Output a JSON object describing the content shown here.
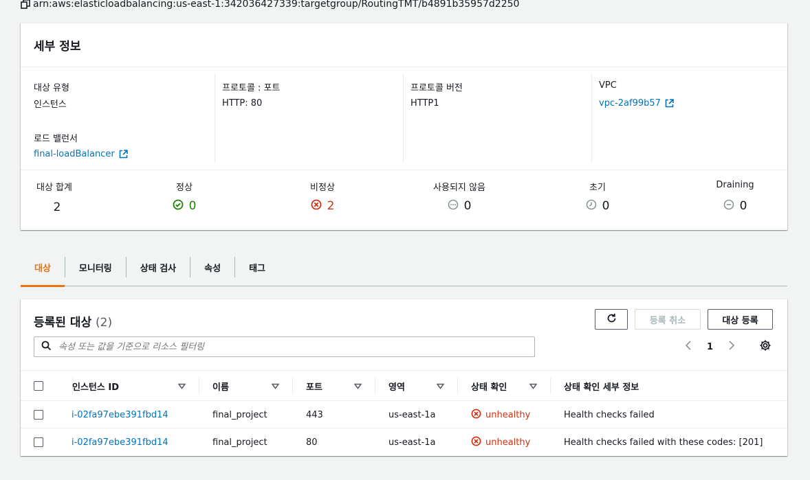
{
  "arn": "arn:aws:elasticloadbalancing:us-east-1:342036427339:targetgroup/RoutingTMT/b4891b35957d2250",
  "details": {
    "title": "세부 정보",
    "target_type_label": "대상 유형",
    "target_type_value": "인스턴스",
    "load_balancer_label": "로드 밸런서",
    "load_balancer_value": "final-loadBalancer",
    "protocol_port_label": "프로토콜 : 포트",
    "protocol_port_value": "HTTP: 80",
    "protocol_version_label": "프로토콜 버전",
    "protocol_version_value": "HTTP1",
    "vpc_label": "VPC",
    "vpc_value": "vpc-2af99b57"
  },
  "stats": {
    "total_label": "대상 합계",
    "total_value": "2",
    "healthy_label": "정상",
    "healthy_value": "0",
    "unhealthy_label": "비정상",
    "unhealthy_value": "2",
    "unused_label": "사용되지 않음",
    "unused_value": "0",
    "initial_label": "초기",
    "initial_value": "0",
    "draining_label": "Draining",
    "draining_value": "0"
  },
  "tabs": [
    {
      "label": "대상",
      "active": true
    },
    {
      "label": "모니터링",
      "active": false
    },
    {
      "label": "상태 검사",
      "active": false
    },
    {
      "label": "속성",
      "active": false
    },
    {
      "label": "태그",
      "active": false
    }
  ],
  "targets": {
    "title": "등록된 대상",
    "count": "(2)",
    "deregister_label": "등록 취소",
    "register_label": "대상 등록",
    "search_placeholder": "속성 또는 값을 기준으로 리소스 필터링",
    "page": "1",
    "columns": [
      "인스턴스 ID",
      "이름",
      "포트",
      "영역",
      "상태 확인",
      "상태 확인 세부 정보"
    ],
    "rows": [
      {
        "id": "i-02fa97ebe391fbd14",
        "name": "final_project",
        "port": "443",
        "zone": "us-east-1a",
        "health": "unhealthy",
        "detail": "Health checks failed"
      },
      {
        "id": "i-02fa97ebe391fbd14",
        "name": "final_project",
        "port": "80",
        "zone": "us-east-1a",
        "health": "unhealthy",
        "detail": "Health checks failed with these codes: [201]"
      }
    ]
  },
  "icons": {
    "copy": "copy-icon",
    "external": "external-link-icon",
    "healthy": "check-circle-icon",
    "unhealthy": "x-circle-icon",
    "unused": "dots-circle-icon",
    "initial": "clock-icon",
    "draining": "minus-circle-icon",
    "refresh": "refresh-icon",
    "search": "search-icon",
    "gear": "gear-icon"
  },
  "colors": {
    "link": "#0073bb",
    "healthy": "#1d8102",
    "unhealthy": "#d13212",
    "active_tab": "#ec7211"
  }
}
